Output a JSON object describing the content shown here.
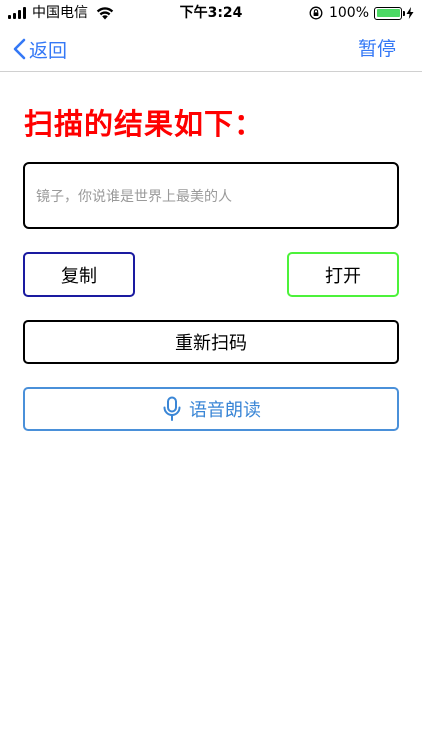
{
  "status_bar": {
    "carrier": "中国电信",
    "time": "下午3:24",
    "battery_percent": "100%",
    "battery_level": 1.0,
    "icons": [
      "signal-icon",
      "wifi-icon",
      "orientation-lock-icon",
      "battery-icon",
      "charging-bolt-icon"
    ]
  },
  "nav": {
    "back_label": "返回",
    "pause_label": "暂停"
  },
  "main": {
    "title": "扫描的结果如下：",
    "result_text": "镜子，你说谁是世界上最美的人",
    "copy_label": "复制",
    "open_label": "打开",
    "rescan_label": "重新扫码",
    "read_aloud_label": "语音朗读"
  },
  "colors": {
    "accent": "#3478f6",
    "title_red": "#ff0000",
    "copy_border": "#1a1aa0",
    "open_border": "#4cf23a",
    "read_border": "#4a90d9",
    "battery_green": "#4cd964"
  }
}
